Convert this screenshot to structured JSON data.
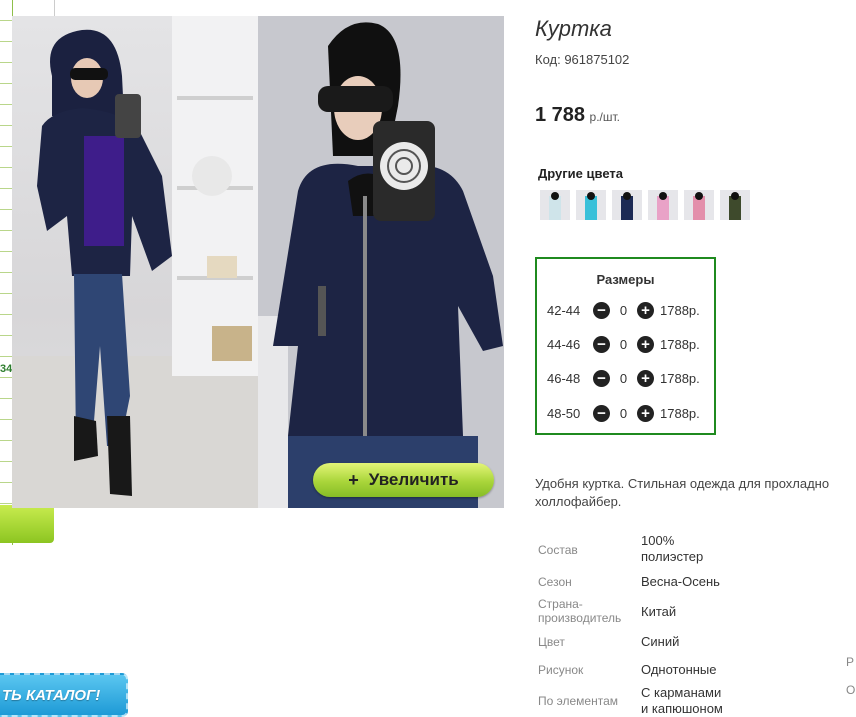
{
  "sidebar": {
    "visible_number": "34"
  },
  "product": {
    "title": "Куртка",
    "code": "Код: 961875102",
    "price_value": "1 788",
    "price_unit": "р./шт.",
    "zoom_label": "Увеличить",
    "zoom_icon": "+",
    "other_colors_heading": "Другие цвета",
    "swatches": [
      {
        "color": "#cfe4ea"
      },
      {
        "color": "#39c0d9"
      },
      {
        "color": "#1c2a55"
      },
      {
        "color": "#e9a2c7"
      },
      {
        "color": "#e38fab"
      },
      {
        "color": "#3e4a2c"
      }
    ],
    "sizes_heading": "Размеры",
    "sizes": [
      {
        "label": "42-44",
        "qty": "0",
        "price": "1788р."
      },
      {
        "label": "44-46",
        "qty": "0",
        "price": "1788р."
      },
      {
        "label": "46-48",
        "qty": "0",
        "price": "1788р."
      },
      {
        "label": "48-50",
        "qty": "0",
        "price": "1788р."
      }
    ],
    "description": "Удобня куртка. Стильная одежда для прохладно\nхоллофайбер.",
    "properties": [
      {
        "key": "Состав",
        "value": "100%\nполиэстер"
      },
      {
        "key": "Сезон",
        "value": "Весна-Осень"
      },
      {
        "key": "Страна-\nпроизводитель",
        "value": "Китай"
      },
      {
        "key": "Цвет",
        "value": "Синий"
      },
      {
        "key": "Рисунок",
        "value": "Однотонные"
      },
      {
        "key": "По элементам",
        "value": "С карманами\nи капюшоном"
      }
    ],
    "cut_letters": [
      "Р",
      "О"
    ]
  },
  "catalog_button": {
    "label": "ТЬ КАТАЛОГ!"
  },
  "colors": {
    "accent_green": "#1f8a1f",
    "jacket_navy": "#1d2444"
  }
}
